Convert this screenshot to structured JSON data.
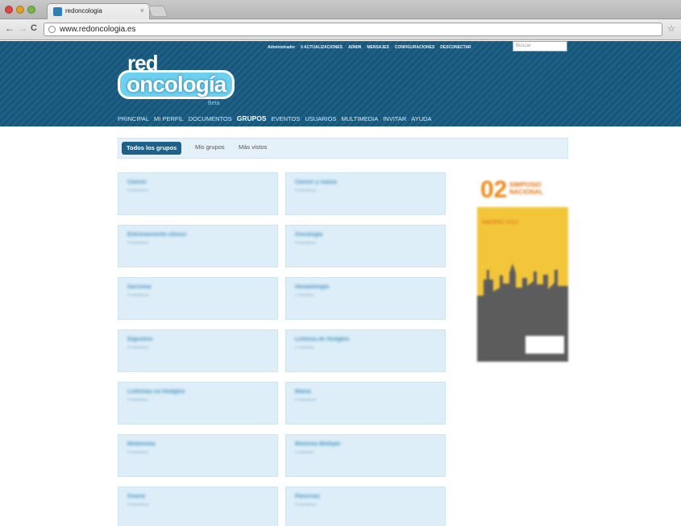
{
  "browser": {
    "tab_title": "redoncologia",
    "tab_close": "×",
    "url": "www.redoncologia.es"
  },
  "header": {
    "topbar": [
      "Administrador",
      "0 ACTUALIZACIONES",
      "ADMIN",
      "MENSAJES",
      "CONFIGURACIONES",
      "DESCONECTAR"
    ],
    "search_placeholder": "Buscar",
    "logo_red": "red",
    "logo_main": "oncología",
    "logo_beta": "Beta",
    "nav": [
      "PRINCIPAL",
      "MI PERFIL",
      "DOCUMENTOS",
      "GRUPOS",
      "EVENTOS",
      "USUARIOS",
      "MULTIMEDIA",
      "INVITAR",
      "AYUDA"
    ],
    "nav_active": "GRUPOS"
  },
  "subtabs": {
    "all": "Todos los grupos",
    "mine": "Mis grupos",
    "most": "Más vistos"
  },
  "groups": [
    {
      "title": "Cáncer",
      "sub": "0 miembros"
    },
    {
      "title": "Cáncer y mama",
      "sub": "0 miembros"
    },
    {
      "title": "Entrenamiento clínico",
      "sub": "0 miembros"
    },
    {
      "title": "Oncología",
      "sub": "0 miembros"
    },
    {
      "title": "Sarcoma",
      "sub": "0 miembros"
    },
    {
      "title": "Hematología",
      "sub": "1 miembro"
    },
    {
      "title": "Digestivo",
      "sub": "0 miembros"
    },
    {
      "title": "Linfoma de Hodgkin",
      "sub": "1 miembro"
    },
    {
      "title": "Linfomas no Hodgkin",
      "sub": "0 miembros"
    },
    {
      "title": "Mama",
      "sub": "0 miembros"
    },
    {
      "title": "Melanoma",
      "sub": "0 miembros"
    },
    {
      "title": "Mieloma Múltiple",
      "sub": "1 miembro"
    },
    {
      "title": "Ovario",
      "sub": "0 miembros"
    },
    {
      "title": "Páncreas",
      "sub": "0 miembros"
    }
  ],
  "poster": {
    "number": "02",
    "title": "SIMPOSIO NACIONAL",
    "dates": "MADRID 2012"
  },
  "colors": {
    "header_blue": "#1f6089",
    "card_bg": "#ddeef8",
    "poster_yellow": "#f3c63a"
  }
}
